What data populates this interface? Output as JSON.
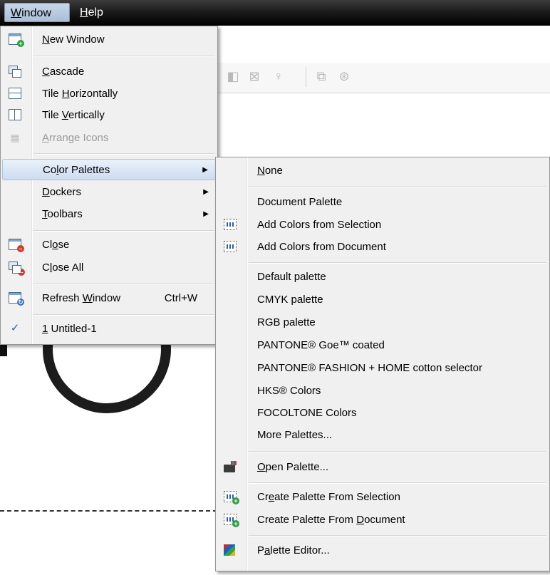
{
  "menubar": {
    "items": [
      {
        "label": "Window",
        "mnemonic": "W",
        "rest": "indow",
        "active": true
      },
      {
        "label": "Help",
        "mnemonic": "H",
        "rest": "elp",
        "active": false
      }
    ]
  },
  "window_menu": {
    "items": [
      {
        "pre": "",
        "mn": "N",
        "post": "ew Window",
        "icon": "new-window-icon"
      },
      {
        "pre": "",
        "mn": "C",
        "post": "ascade",
        "icon": "cascade-icon"
      },
      {
        "pre": "Tile ",
        "mn": "H",
        "post": "orizontally",
        "icon": "tile-horizontally-icon"
      },
      {
        "pre": "Tile ",
        "mn": "V",
        "post": "ertically",
        "icon": "tile-vertically-icon"
      },
      {
        "pre": "",
        "mn": "A",
        "post": "rrange Icons",
        "icon": "arrange-icons-icon",
        "disabled": true
      },
      {
        "pre": "Co",
        "mn": "l",
        "post": "or Palettes",
        "submenu": true,
        "highlighted": true
      },
      {
        "pre": "",
        "mn": "D",
        "post": "ockers",
        "submenu": true
      },
      {
        "pre": "",
        "mn": "T",
        "post": "oolbars",
        "submenu": true
      },
      {
        "pre": "Cl",
        "mn": "o",
        "post": "se",
        "icon": "close-window-icon"
      },
      {
        "pre": "C",
        "mn": "l",
        "post": "ose All",
        "icon": "close-all-icon"
      },
      {
        "pre": "Refresh ",
        "mn": "W",
        "post": "indow",
        "icon": "refresh-window-icon",
        "shortcut": "Ctrl+W"
      },
      {
        "pre": "",
        "mn": "1",
        "post": " Untitled-1",
        "icon": "checkmark-icon",
        "checked": true
      }
    ],
    "arrow": "▶"
  },
  "palettes_menu": {
    "items": [
      {
        "pre": "",
        "mn": "N",
        "post": "one"
      },
      {
        "pre": "Document Palette",
        "mn": "",
        "post": ""
      },
      {
        "pre": "Add Colors from Selection",
        "mn": "",
        "post": "",
        "icon": "add-colors-selection-icon"
      },
      {
        "pre": "Add Colors from Document",
        "mn": "",
        "post": "",
        "icon": "add-colors-document-icon"
      },
      {
        "pre": "Default palette",
        "mn": "",
        "post": ""
      },
      {
        "pre": "CMYK palette",
        "mn": "",
        "post": ""
      },
      {
        "pre": "RGB palette",
        "mn": "",
        "post": ""
      },
      {
        "pre": "PANTONE® Goe™ coated",
        "mn": "",
        "post": ""
      },
      {
        "pre": "PANTONE® FASHION + HOME cotton selector",
        "mn": "",
        "post": ""
      },
      {
        "pre": "HKS® Colors",
        "mn": "",
        "post": ""
      },
      {
        "pre": "FOCOLTONE Colors",
        "mn": "",
        "post": ""
      },
      {
        "pre": "More Palettes...",
        "mn": "",
        "post": ""
      },
      {
        "pre": "",
        "mn": "O",
        "post": "pen Palette...",
        "icon": "open-palette-icon"
      },
      {
        "pre": "Cr",
        "mn": "e",
        "post": "ate Palette From Selection",
        "icon": "create-palette-selection-icon"
      },
      {
        "pre": "Create Palette From ",
        "mn": "D",
        "post": "ocument",
        "icon": "create-palette-document-icon"
      },
      {
        "pre": "P",
        "mn": "a",
        "post": "lette Editor...",
        "icon": "palette-editor-icon"
      }
    ]
  }
}
